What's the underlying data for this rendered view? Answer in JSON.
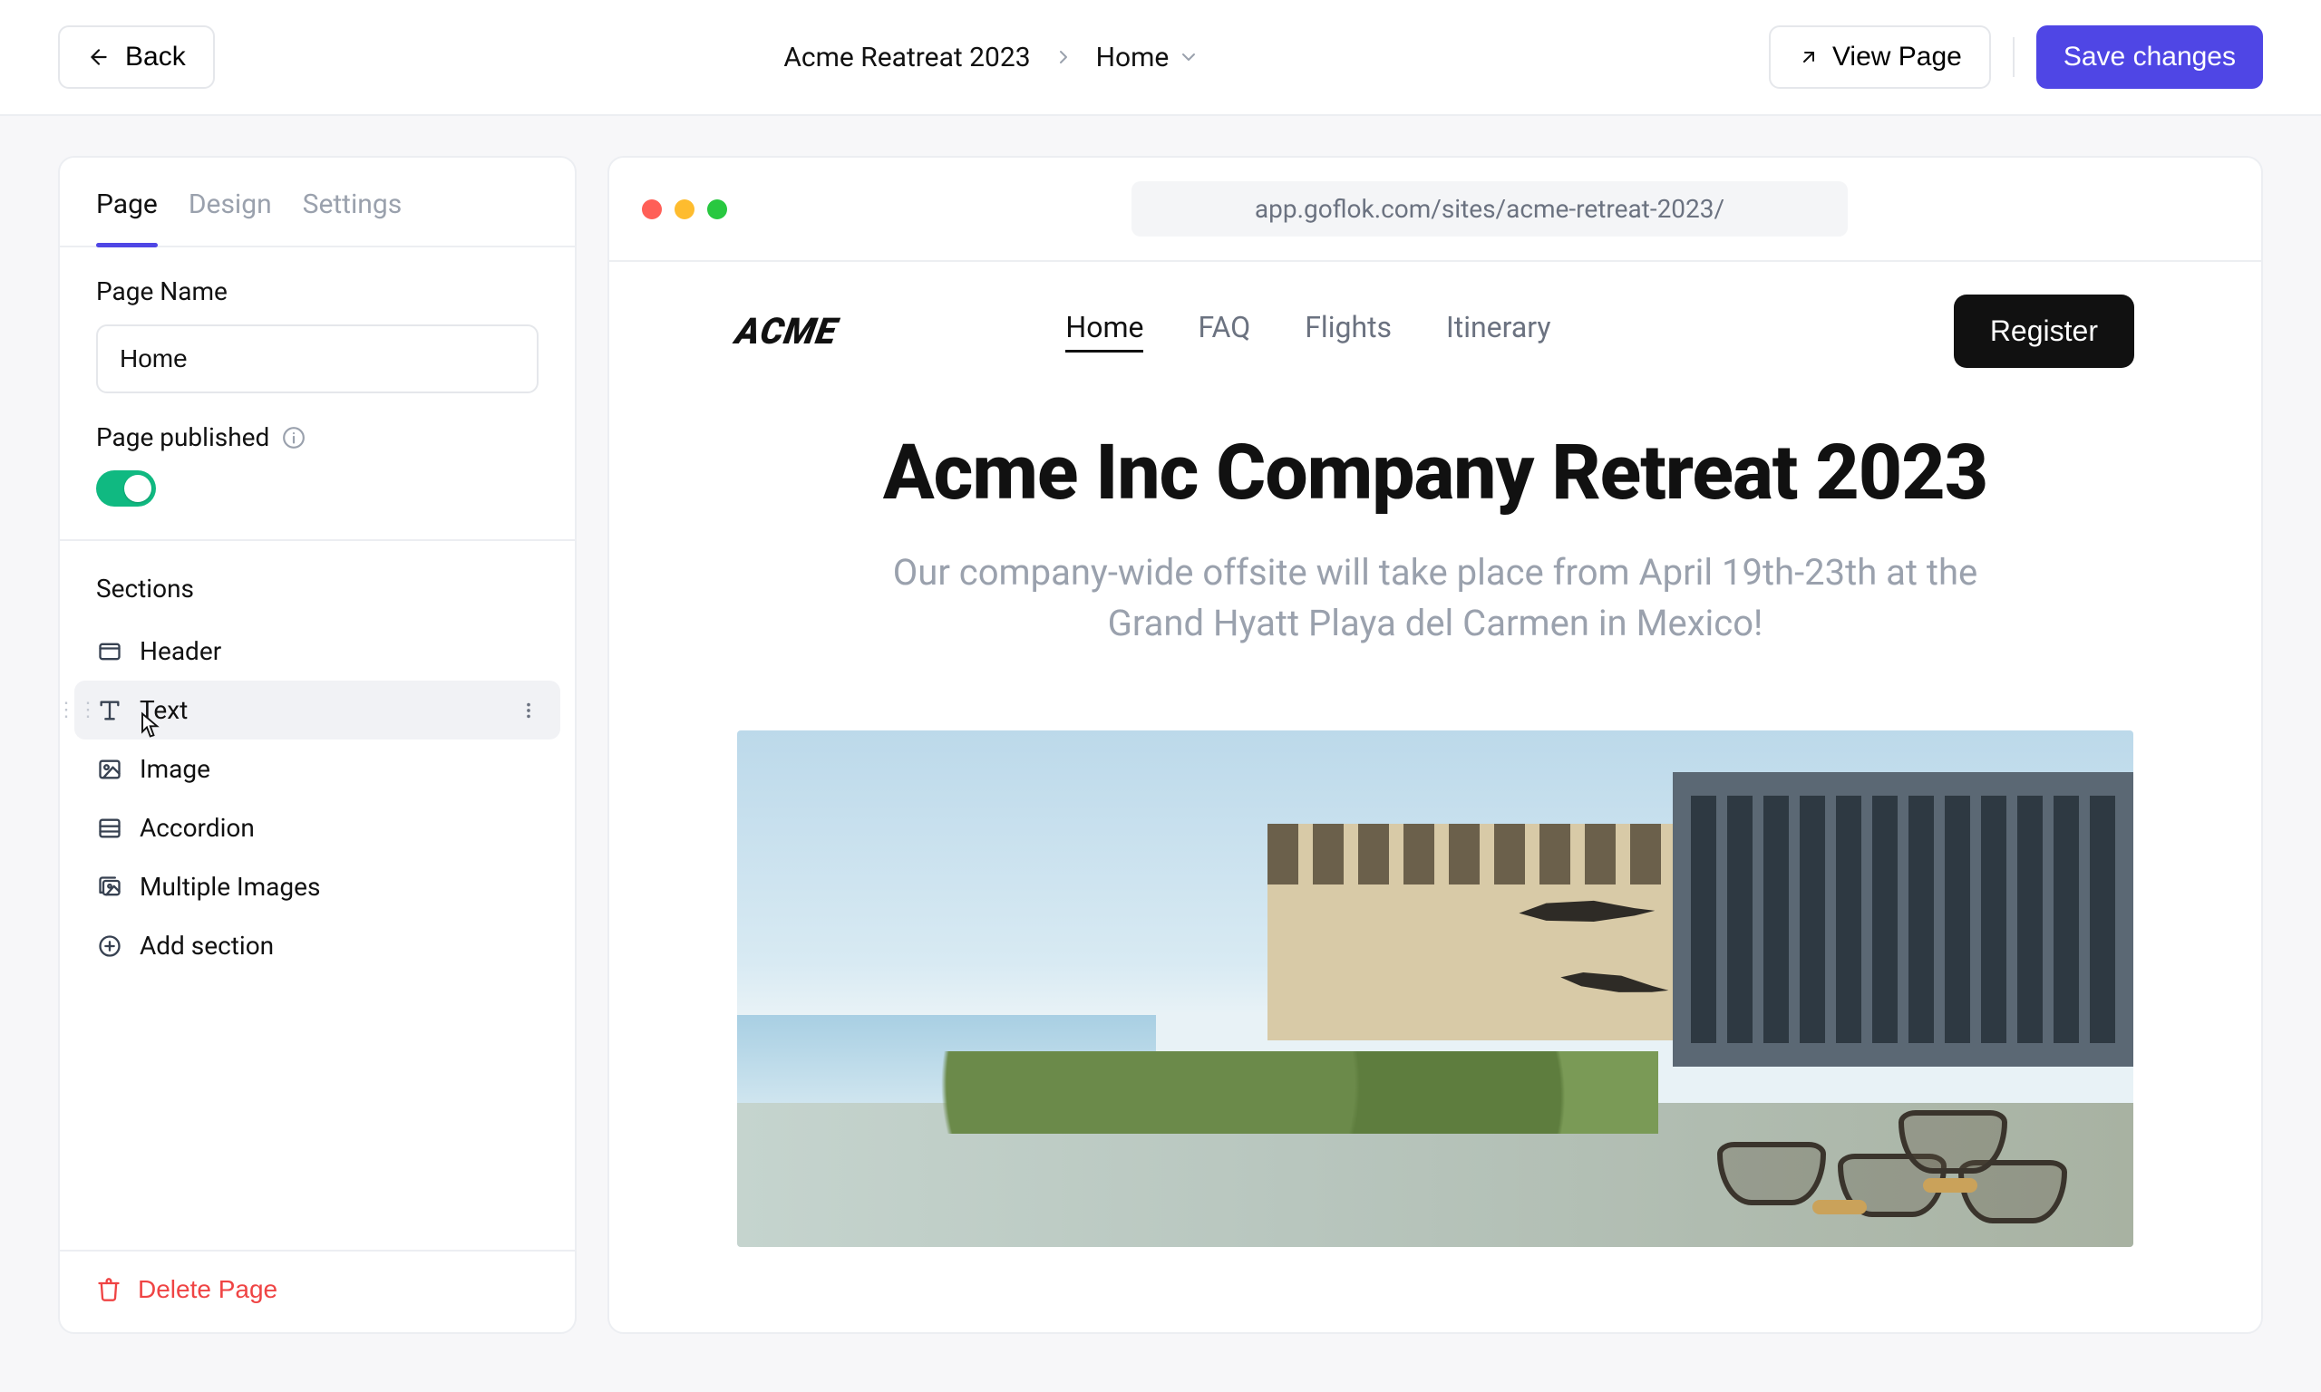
{
  "topbar": {
    "back": "Back",
    "crumb_site": "Acme Reatreat 2023",
    "crumb_page": "Home",
    "view_page": "View Page",
    "save": "Save changes"
  },
  "sidebar": {
    "tabs": {
      "page": "Page",
      "design": "Design",
      "settings": "Settings",
      "active": "page"
    },
    "page_name_label": "Page Name",
    "page_name_value": "Home",
    "published_label": "Page published",
    "published": true,
    "sections_label": "Sections",
    "sections": [
      {
        "icon": "window",
        "label": "Header"
      },
      {
        "icon": "type",
        "label": "Text",
        "hover": true
      },
      {
        "icon": "image",
        "label": "Image"
      },
      {
        "icon": "rows",
        "label": "Accordion"
      },
      {
        "icon": "images",
        "label": "Multiple Images"
      }
    ],
    "add_section": "Add section",
    "delete_page": "Delete Page"
  },
  "preview": {
    "url": "app.goflok.com/sites/acme-retreat-2023/",
    "logo": "ACME",
    "nav": {
      "home": "Home",
      "faq": "FAQ",
      "flights": "Flights",
      "itinerary": "Itinerary"
    },
    "register": "Register",
    "hero_title": "Acme Inc Company Retreat 2023",
    "hero_sub": "Our company-wide offsite will take place from April 19th-23th at the Grand Hyatt Playa del Carmen in Mexico!"
  }
}
